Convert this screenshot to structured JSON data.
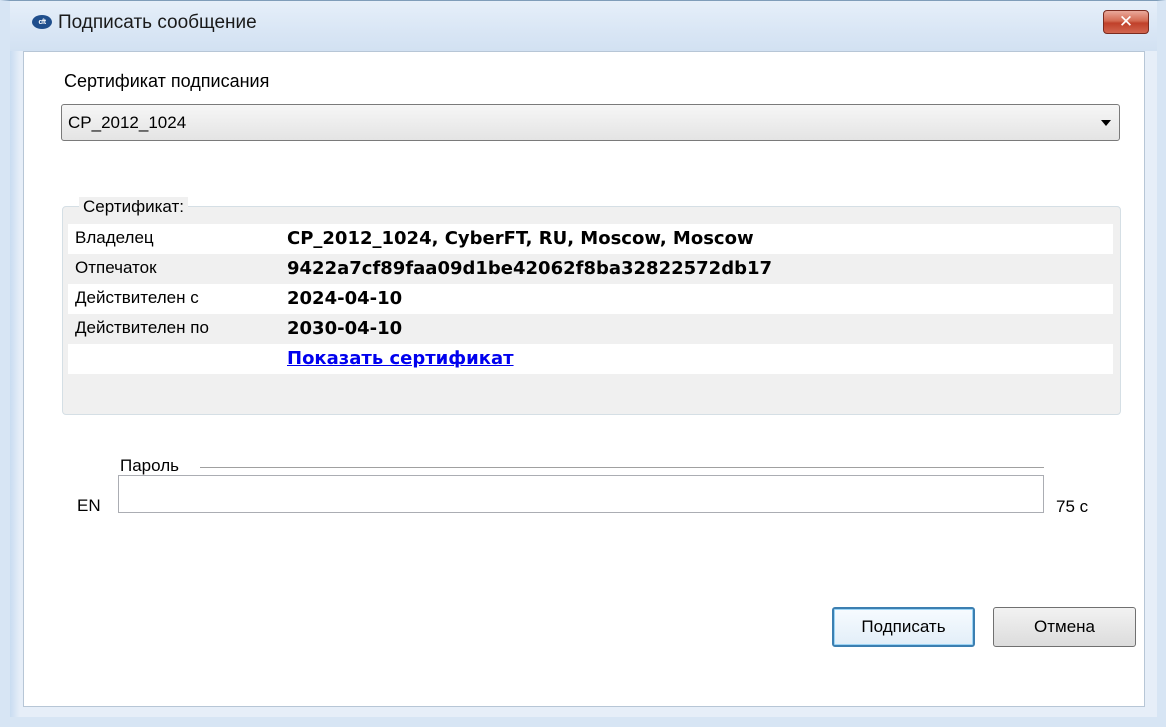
{
  "window": {
    "title": "Подписать сообщение",
    "icon": "cyberft-logo-icon",
    "icon_text": "cft",
    "close_glyph": "✕"
  },
  "signing_certificate": {
    "label": "Сертификат подписания",
    "selected": "CP_2012_1024"
  },
  "certificate": {
    "legend": "Сертификат:",
    "rows": [
      {
        "key": "Владелец",
        "value": "CP_2012_1024, CyberFT, RU, Moscow, Moscow"
      },
      {
        "key": "Отпечаток",
        "value": "9422a7cf89faa09d1be42062f8ba32822572db17"
      },
      {
        "key": "Действителен с",
        "value": "2024-04-10"
      },
      {
        "key": "Действителен по",
        "value": "2030-04-10"
      }
    ],
    "show_link": "Показать сертификат"
  },
  "password": {
    "label": "Пароль",
    "value": "",
    "language": "EN",
    "timer": "75 с"
  },
  "buttons": {
    "sign": "Подписать",
    "cancel": "Отмена"
  },
  "colors": {
    "link": "#0000ee",
    "close_button": "#c0402a",
    "primary_border": "#3c7fb1"
  }
}
